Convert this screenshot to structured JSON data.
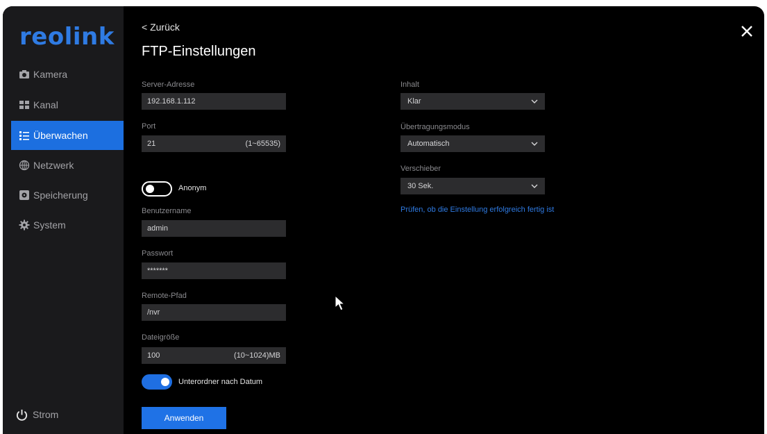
{
  "brand": {
    "logo": "reolink",
    "accent": "#1f72e6"
  },
  "sidebar": {
    "items": [
      {
        "label": "Kamera",
        "icon": "camera-icon"
      },
      {
        "label": "Kanal",
        "icon": "channel-grid-icon"
      },
      {
        "label": "Überwachen",
        "icon": "list-icon",
        "active": true
      },
      {
        "label": "Netzwerk",
        "icon": "globe-icon"
      },
      {
        "label": "Speicherung",
        "icon": "storage-icon"
      },
      {
        "label": "System",
        "icon": "gear-icon"
      }
    ],
    "power_label": "Strom"
  },
  "header": {
    "back_label": "Zurück",
    "title": "FTP-Einstellungen"
  },
  "form": {
    "server": {
      "label": "Server-Adresse",
      "value": "192.168.1.112"
    },
    "port": {
      "label": "Port",
      "value": "21",
      "hint": "(1~65535)"
    },
    "anonym": {
      "label": "Anonym",
      "enabled": false
    },
    "username": {
      "label": "Benutzername",
      "value": "admin"
    },
    "password": {
      "label": "Passwort",
      "value": "*******"
    },
    "remote_path": {
      "label": "Remote-Pfad",
      "value": "/nvr"
    },
    "filesize": {
      "label": "Dateigröße",
      "value": "100",
      "hint": "(10~1024)MB"
    },
    "subfolder": {
      "label": "Unterordner nach Datum",
      "enabled": true
    },
    "apply_label": "Anwenden"
  },
  "right": {
    "content": {
      "label": "Inhalt",
      "value": "Klar"
    },
    "mode": {
      "label": "Übertragungsmodus",
      "value": "Automatisch"
    },
    "delay": {
      "label": "Verschieber",
      "value": "30 Sek."
    },
    "test_link": "Prüfen, ob die Einstellung erfolgreich fertig ist"
  }
}
